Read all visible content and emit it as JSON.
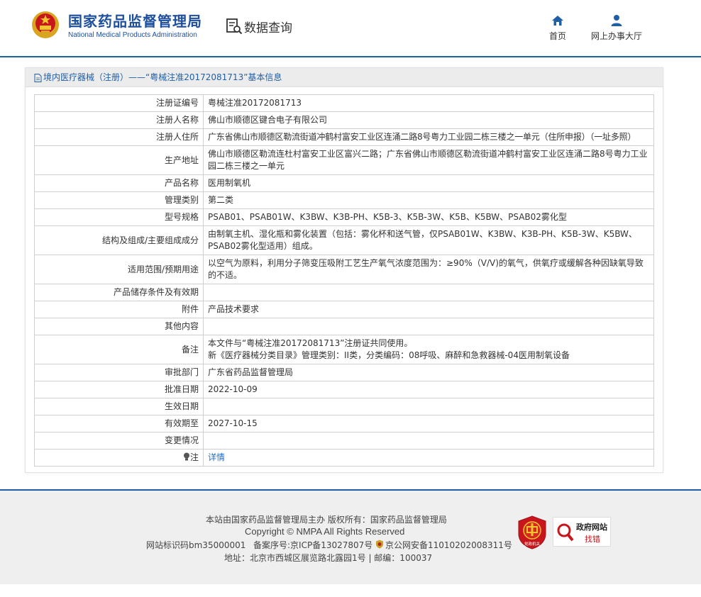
{
  "header": {
    "logo_cn": "国家药品监督管理局",
    "logo_en": "National Medical Products Administration",
    "section_title": "数据查询",
    "nav": [
      {
        "label": "首页",
        "icon": "home-icon"
      },
      {
        "label": "网上办事大厅",
        "icon": "user-icon"
      }
    ]
  },
  "panel": {
    "breadcrumb": "境内医疗器械（注册）——“粤械注准20172081713”基本信息",
    "rows": [
      {
        "label": "注册证编号",
        "value": "粤械注准20172081713"
      },
      {
        "label": "注册人名称",
        "value": "佛山市顺德区键合电子有限公司"
      },
      {
        "label": "注册人住所",
        "value": "广东省佛山市顺德区勒流街道冲鹤村富安工业区连涌二路8号粤力工业园二栋三楼之一单元（住所申报）（一址多照）"
      },
      {
        "label": "生产地址",
        "value": "佛山市顺德区勒流连杜村富安工业区富兴二路；广东省佛山市顺德区勒流街道冲鹤村富安工业区连涌二路8号粤力工业园二栋三楼之一单元"
      },
      {
        "label": "产品名称",
        "value": "医用制氧机"
      },
      {
        "label": "管理类别",
        "value": "第二类"
      },
      {
        "label": "型号规格",
        "value": "PSAB01、PSAB01W、K3BW、K3B-PH、K5B-3、K5B-3W、K5B、K5BW、PSAB02雾化型"
      },
      {
        "label": "结构及组成/主要组成成分",
        "value": "由制氧主机、湿化瓶和雾化装置（包括：雾化杯和送气管，仅PSAB01W、K3BW、K3B-PH、K5B-3W、K5BW、PSAB02雾化型适用）组成。"
      },
      {
        "label": "适用范围/预期用途",
        "value": "以空气为原料，利用分子筛变压吸附工艺生产氧气浓度范围为：≥90%（V/V)的氧气，供氧疗或缓解各种因缺氧导致的不适。"
      },
      {
        "label": "产品储存条件及有效期",
        "value": ""
      },
      {
        "label": "附件",
        "value": "产品技术要求"
      },
      {
        "label": "其他内容",
        "value": ""
      },
      {
        "label": "备注",
        "value": "本文件与“粤械注准20172081713”注册证共同使用。",
        "value2": "新《医疗器械分类目录》管理类别：II类，分类编码：08呼吸、麻醉和急救器械-04医用制氧设备"
      },
      {
        "label": "审批部门",
        "value": "广东省药品监督管理局"
      },
      {
        "label": "批准日期",
        "value": "2022-10-09"
      },
      {
        "label": "生效日期",
        "value": ""
      },
      {
        "label": "有效期至",
        "value": "2027-10-15"
      },
      {
        "label": "变更情况",
        "value": ""
      }
    ],
    "note_label": "注",
    "note_link": "详情"
  },
  "footer": {
    "line1": "本站由国家药品监督管理局主办 版权所有：国家药品监督管理局",
    "line2": "Copyright © NMPA All Rights Reserved",
    "site_id": "网站标识码bm35000001",
    "icp": "备案序号:京ICP备13027807号",
    "police": "京公网安备11010202008311号",
    "address": "地址：北京市西城区展览路北露园1号 | 邮编：100037",
    "badge_red_text": "党政机关",
    "badge_zf_title": "政府网站",
    "badge_zf_sub": "找错"
  },
  "colors": {
    "brand_blue": "#1f5fa6",
    "link_blue": "#1f6fc7",
    "footer_bg": "#efefef"
  }
}
